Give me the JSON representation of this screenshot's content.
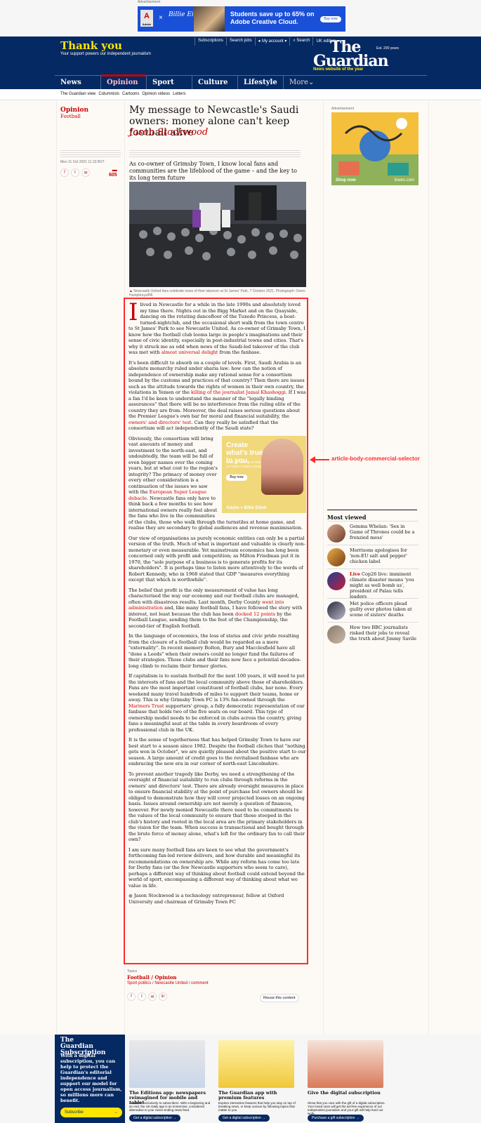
{
  "ad_top": {
    "label": "Advertisement",
    "brand": "Adobe",
    "x": "×",
    "artist": "Billie Eilish",
    "headline": "Students save up to 65% on Adobe Creative Cloud.",
    "cta": "Buy now"
  },
  "header": {
    "thank_you": "Thank you",
    "support_text": "Your support powers our independent journalism",
    "links": [
      "Subscriptions",
      "Search jobs",
      "My account",
      "Search",
      "UK edition"
    ],
    "logo_line1": "The",
    "logo_line2": "Guardian",
    "est": "Est. 200 years",
    "tagline": "News website of the year"
  },
  "nav": {
    "pillars": [
      "News",
      "Opinion",
      "Sport",
      "Culture",
      "Lifestyle"
    ],
    "more": "More",
    "sub": [
      "The Guardian view",
      "Columnists",
      "Cartoons",
      "Opinion videos",
      "Letters"
    ]
  },
  "article": {
    "section": "Opinion",
    "subsection": "Football",
    "headline": "My message to Newcastle's Saudi owners: money alone can't keep football alive",
    "byline": "Jason Stockwood",
    "date": "Mon 11 Oct 2021 11.33 BST",
    "comments": "605",
    "standfirst": "As co-owner of Grimsby Town, I know local fans and communities are the lifeblood of the game – and the key to its long term future",
    "caption": "Newcastle United fans celebrate news of their takeover at St James' Park, 7 October 2021. Photograph: Owen Humphreys/PA",
    "share": [
      "f",
      "t",
      "✉"
    ],
    "p1": "lived in Newcastle for a while in the late 1990s and absolutely loved my time there. Nights out in the Bigg Market and on the Quayside, dancing on the rotating dancefloor of the Tuxedo Princess, a boat-turned-nightclub, and the occasional short walk from the town centre to St James' Park to see Newcastle United. As co-owner of Grimsby Town, I know how the football club looms large in people's imaginations and their sense of civic identity, especially in post-industrial towns and cities. That's why it struck me as odd when news of the Saudi-led takeover of the club was met with ",
    "p1_link": "almost universal delight",
    "p1_end": " from the fanbase.",
    "p2a": "It's been difficult to absorb on a couple of levels. First, Saudi Arabia is an absolute monarchy ruled under sharia law: how can the notion of independence of ownership make any rational sense for a consortium bound by the customs and practices of that country? Then there are issues such as the attitude towards the rights of women in their own country, the violations in Yemen or the ",
    "p2_link": "killing of the journalist Jamal Khashoggi",
    "p2b": ". If I was a fan I'd be keen to understand the manner of the \"legally binding assurances\" that there will be no interference from the ruling elite of the country they are from. Moreover, the deal raises serious questions about the Premier League's own bar for moral and financial suitability, the ",
    "p2_link2": "owners' and directors' test",
    "p2c": ". Can they really be satisfied that the consortium will act independently of the Saudi state?",
    "inline_ad_label": "Advertisement",
    "inline_ad_title": "Create what's true to you.",
    "inline_ad_sub": "Students save up to 65% on Adobe Creative Cloud.",
    "inline_ad_cta": "Buy now",
    "inline_ad_foot": "Adobe × Billie Eilish",
    "p3a": "Obviously, the consortium will bring vast amounts of money and investment to the north-east, and undoubtedly, the team will be full of even bigger names over the coming years, but at what cost to the region's integrity? The primacy of money over every other consideration is a continuation of the issues we saw with the ",
    "p3_link": "European Super League debacle",
    "p3b": ". Newcastle fans only have to think back a few months to see how international owners really feel about the fans who live in the communities of the clubs, those who walk through the turnstiles at home game, and realise they are secondary to global audiences and revenue maximisation.",
    "p4": "Our view of organisations as purely economic entities can only be a partial version of the truth. Much of what is important and valuable is clearly non-monetary or even measurable. Yet mainstream economics has long been concerned only with profit and competition; as Milton Friedman put it in 1970, the \"sole purpose of a business is to generate profits for its shareholders\". It is perhaps time to listen more attentively to the words of Robert Kennedy, who in 1968 stated that GDP \"measures everything except that which is worthwhile\".",
    "p5a": "The belief that profit is the only measurement of value has long characterised the way our economy and our football clubs are managed, often with disastrous results. Last month, Derby County ",
    "p5_link": "went into administration",
    "p5b": " and, like many football fans, I have followed the story with interest, not least because the club has been ",
    "p5_link2": "docked 12 points",
    "p5c": " by the Football League, sending them to the foot of the Championship, the second-tier of English football.",
    "p6": "In the language of economics, the loss of status and civic pride resulting from the closure of a football club would be regarded as a mere \"externality\". In recent memory Bolton, Bury and Macclesfield have all \"done a Leeds\" when their owners could no longer fund the failures of their strategies. Those clubs and their fans now face a potential decades-long climb to reclaim their former glories.",
    "p7a": "If capitalism is to sustain football for the next 100 years, it will need to put the interests of fans and the local community above those of shareholders. Fans are the most important constituent of football clubs, bar none. Every weekend many travel hundreds of miles to support their teams, home or away. This is why Grimsby Town FC is 13% fan-owned through the ",
    "p7_link": "Mariners Trust",
    "p7b": " supporters' group, a fully democratic representation of our fanbase that holds two of the five seats on our board. This type of ownership model needs to be enforced in clubs across the country, giving fans a meaningful seat at the table in every boardroom of every professional club in the UK.",
    "p8": "It is the sense of togetherness that has helped Grimsby Town to have our best start to a season since 1982. Despite the football cliches that \"nothing gets won in October\", we are quietly pleased about the positive start to our season. A large amount of credit goes to the revitalised fanbase who are embracing the new era in our corner of north-east Lincolnshire.",
    "p9": "To prevent another tragedy like Derby, we need a strengthening of the oversight of financial suitability to run clubs through reforms in the owners' and directors' test. There are already oversight measures in place to ensure financial stability at the point of purchase but owners should be obliged to demonstrate how they will cover projected losses on an ongoing basis. Issues around ownership are not merely a question of finances, however. For newly monied Newcastle there need to be commitments to the values of the local community to ensure that those steeped in the club's history and rooted in the local area are the primary stakeholders in the vision for the team. When success is transactional and bought through the brute force of money alone, what's left for the ordinary fan to call their own?",
    "p10": "I am sure many football fans are keen to see what the government's forthcoming fan-led review delivers, and how durable and meaningful its recommendations on ownership are. While any reform has come too late for Derby fans (or the few Newcastle supporters who seem to care), perhaps a different way of thinking about football could extend beyond the world of sport, encompassing a different way of thinking about what we value in life.",
    "bio": "Jason Stockwood is a technology entrepreneur, fellow at Oxford University and chairman of Grimsby Town FC",
    "topics_label": "Topics",
    "topics_main": "Football / Opinion",
    "topics_sub": "Sport politics / Newcastle United / comment",
    "reuse": "Reuse this content"
  },
  "right_ad": {
    "label": "Advertisement",
    "shop": "Shop now",
    "brand": "lowes.com"
  },
  "annotation": {
    "label": "article-body-commercial-selector"
  },
  "most_viewed": {
    "title": "Most viewed",
    "items": [
      {
        "text": "Gemma Whelan: 'Sex in Game of Thrones could be a frenzied mess'",
        "live": ""
      },
      {
        "text": "Morrisons apologises for 'non-EU salt and pepper' chicken label",
        "live": ""
      },
      {
        "text": " Cop26 live: imminent climate disaster means 'you might as well bomb us', president of Palau tells leaders",
        "live": "Live"
      },
      {
        "text": "Met police officers plead guilty over photos taken at scene of sisters' deaths",
        "live": ""
      },
      {
        "text": "How two BBC journalists risked their jobs to reveal the truth about Jimmy Savile",
        "live": ""
      }
    ]
  },
  "subscription": {
    "logo1": "The",
    "logo2": "Guardian",
    "logo3": "Subscription",
    "text": "With a digital subscription, you can help to protect the Guardian's editorial independence and support our model for open access journalism, so millions more can benefit.",
    "cta": "Subscribe",
    "cards": [
      {
        "title": "The Editions app: newspapers reimagined for mobile and tablet",
        "desc": "Available exclusively to subscribers. With a beginning and an end, the UK Daily app is an immersive, considered alternative to your never-ending news feed.",
        "cta": "Get a digital subscription →"
      },
      {
        "title": "The Guardian app with premium features",
        "desc": "Explore interactive features that help you stay on top of breaking news, or keep curious by following topics that matter to you.",
        "cta": "Get a digital subscription →"
      },
      {
        "title": "Give the digital subscription",
        "desc": "Show that you care with the gift of a digital subscription. Your loved ones will get the ad-free experience of our independent journalism and your gift will help fund our work.",
        "cta": "Purchase a gift subscription →"
      }
    ]
  }
}
